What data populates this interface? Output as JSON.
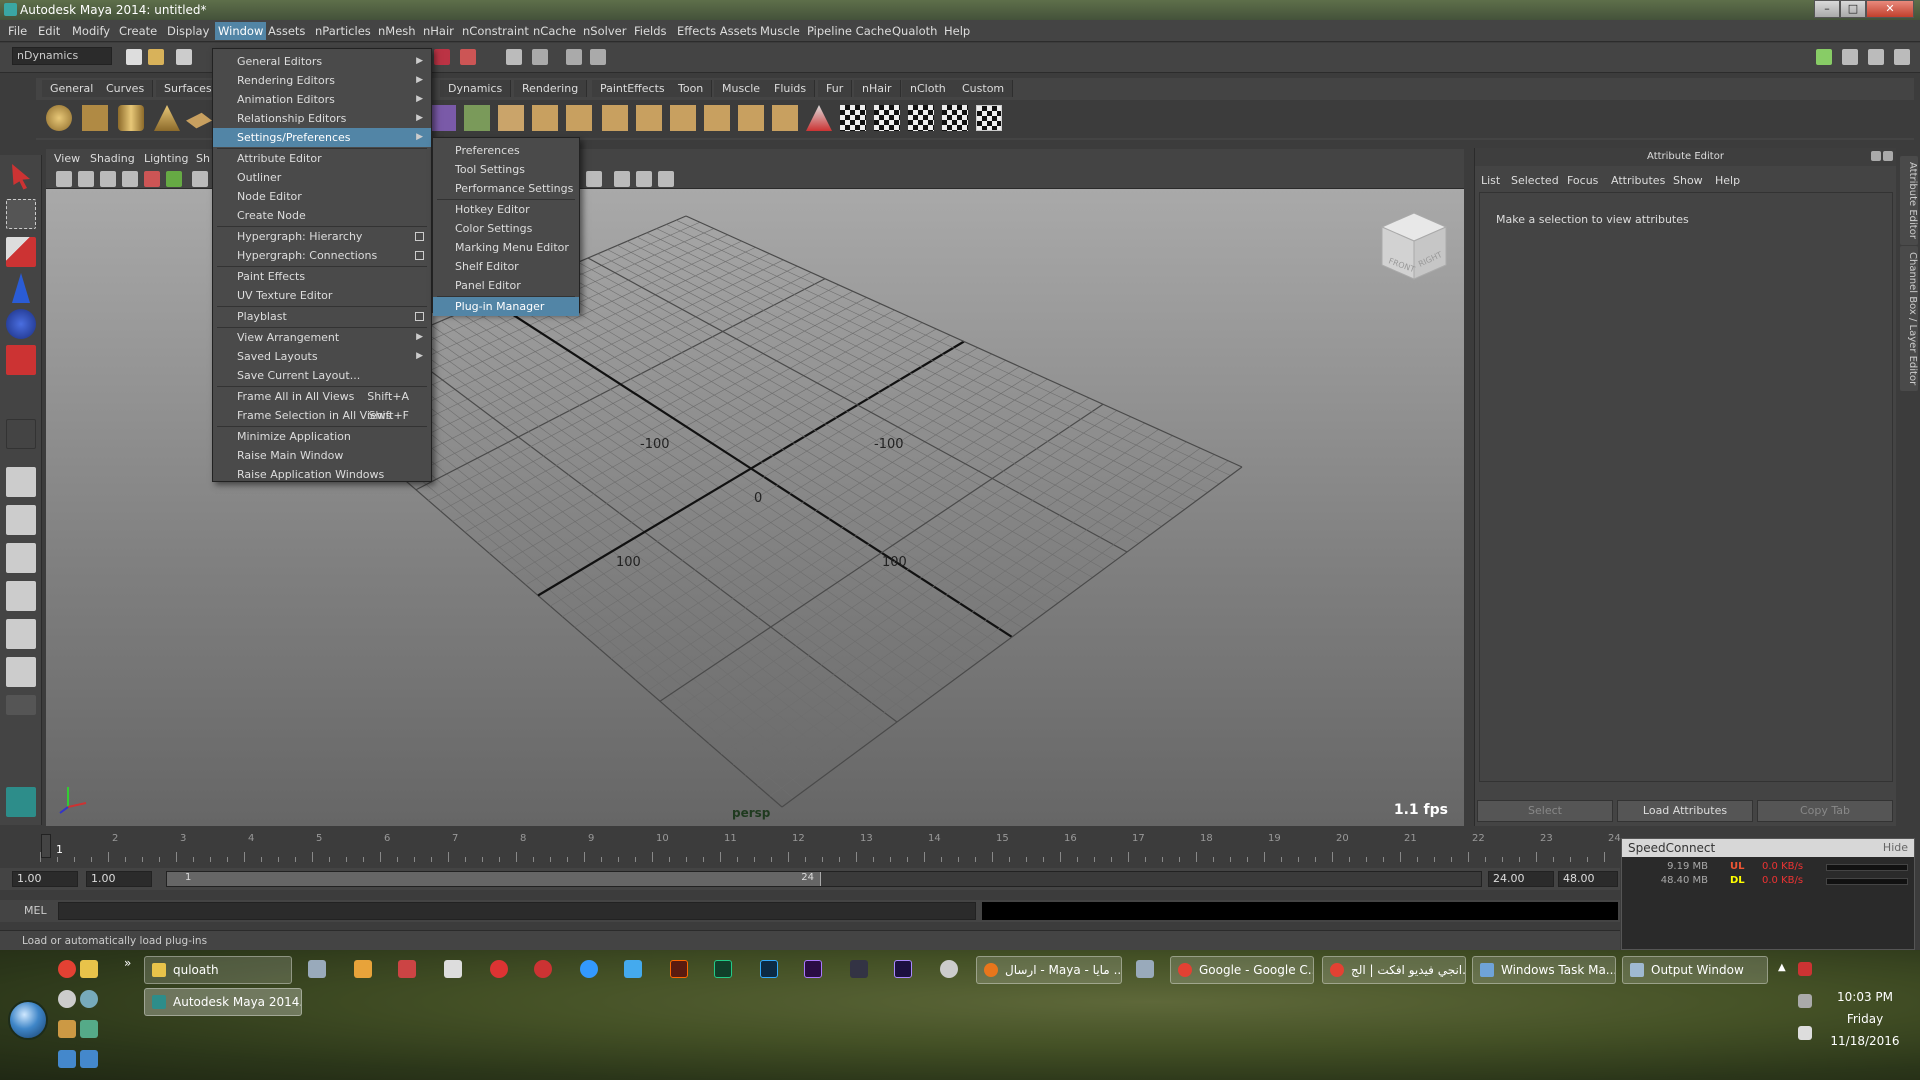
{
  "window": {
    "title": "Autodesk Maya 2014: untitled*",
    "controls": [
      "–",
      "□",
      "✕"
    ]
  },
  "menubar": [
    "File",
    "Edit",
    "Modify",
    "Create",
    "Display",
    "Window",
    "Assets",
    "nParticles",
    "nMesh",
    "nHair",
    "nConstraint",
    "nCache",
    "nSolver",
    "Fields",
    "Effects Assets",
    "Muscle",
    "Pipeline Cache",
    "Qualoth",
    "Help"
  ],
  "active_menu": "Window",
  "statusline": {
    "menu_set": "nDynamics"
  },
  "shelf": {
    "tabs": [
      "General",
      "Curves",
      "Surfaces",
      "Dynamics",
      "Rendering",
      "PaintEffects",
      "Toon",
      "Muscle",
      "Fluids",
      "Fur",
      "nHair",
      "nCloth",
      "Custom"
    ]
  },
  "window_menu": {
    "items": [
      {
        "label": "General Editors",
        "submenu": true
      },
      {
        "label": "Rendering Editors",
        "submenu": true
      },
      {
        "label": "Animation Editors",
        "submenu": true
      },
      {
        "label": "Relationship Editors",
        "submenu": true
      },
      {
        "label": "Settings/Preferences",
        "submenu": true,
        "highlighted": true
      },
      {
        "label": "Attribute Editor"
      },
      {
        "label": "Outliner"
      },
      {
        "label": "Node Editor"
      },
      {
        "label": "Create Node"
      },
      {
        "label": "Hypergraph: Hierarchy",
        "option": true
      },
      {
        "label": "Hypergraph: Connections",
        "option": true
      },
      {
        "label": "Paint Effects"
      },
      {
        "label": "UV Texture Editor"
      },
      {
        "label": "Playblast",
        "option": true
      },
      {
        "label": "View Arrangement",
        "submenu": true
      },
      {
        "label": "Saved Layouts",
        "submenu": true
      },
      {
        "label": "Save Current Layout..."
      },
      {
        "label": "Frame All in All Views",
        "shortcut": "Shift+A"
      },
      {
        "label": "Frame Selection in All Views",
        "shortcut": "Shift+F"
      },
      {
        "label": "Minimize Application"
      },
      {
        "label": "Raise Main Window"
      },
      {
        "label": "Raise Application Windows"
      }
    ]
  },
  "settings_submenu": {
    "items": [
      "Preferences",
      "Tool Settings",
      "Performance Settings",
      "Hotkey Editor",
      "Color Settings",
      "Marking Menu Editor",
      "Shelf Editor",
      "Panel Editor",
      "Plug-in Manager"
    ],
    "highlighted": "Plug-in Manager"
  },
  "viewport": {
    "menu": [
      "View",
      "Shading",
      "Lighting",
      "Sh"
    ],
    "camera": "persp",
    "fps": "1.1 fps",
    "grid_labels": [
      "-100",
      "-100",
      "0",
      "100",
      "100"
    ],
    "viewcube": [
      "FRONT",
      "RIGHT"
    ]
  },
  "attribute_editor": {
    "title": "Attribute Editor",
    "menu": [
      "List",
      "Selected",
      "Focus",
      "Attributes",
      "Show",
      "Help"
    ],
    "hint": "Make a selection to view attributes",
    "buttons": [
      "Select",
      "Load Attributes",
      "Copy Tab"
    ],
    "side_tabs": [
      "Attribute Editor",
      "Channel Box / Layer Editor"
    ]
  },
  "timeline": {
    "ticks": [
      "1",
      "2",
      "3",
      "4",
      "5",
      "6",
      "7",
      "8",
      "9",
      "10",
      "11",
      "12",
      "13",
      "14",
      "15",
      "16",
      "17",
      "18",
      "19",
      "20",
      "21",
      "22",
      "23",
      "24"
    ],
    "current_frame": "1",
    "start": "1.00",
    "start_inner": "1.00",
    "range_start_label": "1",
    "range_end_label": "24",
    "end_inner": "24.00",
    "end": "48.00"
  },
  "command_line": {
    "label": "MEL"
  },
  "help_line": "Load or automatically load plug-ins",
  "speedconnect": {
    "title": "SpeedConnect",
    "hide": "Hide",
    "rows": [
      {
        "amount": "9.19 MB",
        "label": "UL",
        "rate": "0.0 KB/s"
      },
      {
        "amount": "48.40 MB",
        "label": "DL",
        "rate": "0.0 KB/s"
      }
    ]
  },
  "taskbar": {
    "buttons": [
      {
        "label": "quloath",
        "color": "#e8c34a"
      },
      {
        "label": "Autodesk Maya 2014...",
        "color": "#2d8d8a"
      },
      {
        "label": "ارسال - Maya - مايا ...",
        "color": "#e8761c"
      },
      {
        "label": "Google - Google C...",
        "color": "#e34133"
      },
      {
        "label": "انجي فيديو افكت | الج...",
        "color": "#e34133"
      },
      {
        "label": "Windows Task Ma...",
        "color": "#6fa3d8"
      },
      {
        "label": "Output Window",
        "color": "#9fb9d2"
      }
    ],
    "clock": {
      "time": "10:03 PM",
      "day": "Friday",
      "date": "11/18/2016"
    }
  }
}
